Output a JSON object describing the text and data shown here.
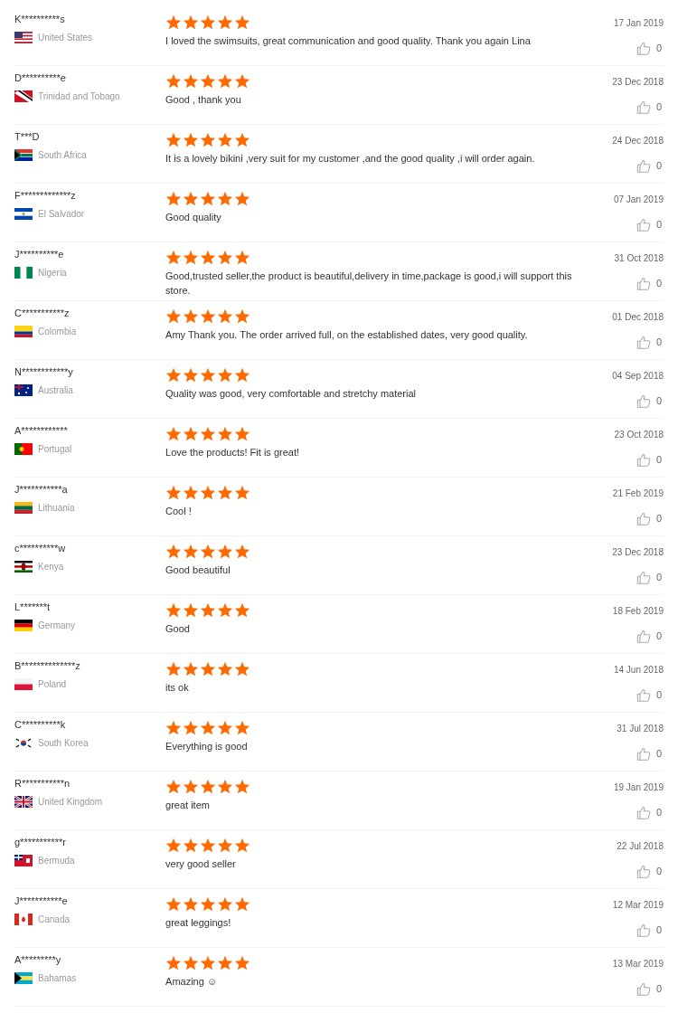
{
  "reviews": [
    {
      "name": "K**********s",
      "country": "United States",
      "kind": "us",
      "stars": 5,
      "text": "I loved the swimsuits, great communication and good quality. Thank you again Lina",
      "date": "17 Jan 2019",
      "likes": "0"
    },
    {
      "name": "D**********e",
      "country": "Trinidad and Tobago",
      "kind": "tt",
      "stars": 5,
      "text": "Good , thank you",
      "date": "23 Dec 2018",
      "likes": "0"
    },
    {
      "name": "T***D",
      "country": "South Africa",
      "kind": "za",
      "stars": 5,
      "text": "It is a lovely bikini ,very suit for my customer ,and the good quality ,i will order again.",
      "date": "24 Dec 2018",
      "likes": "0"
    },
    {
      "name": "F*************z",
      "country": "El Salvador",
      "kind": "sv",
      "stars": 5,
      "text": "Good quality",
      "date": "07 Jan 2019",
      "likes": "0"
    },
    {
      "name": "J**********e",
      "country": "Nigeria",
      "kind": "ng",
      "stars": 5,
      "text": "Good,trusted seller,the product is beautiful,delivery in time,package is good,i will support this store.",
      "date": "31 Oct 2018",
      "likes": "0"
    },
    {
      "name": "C***********z",
      "country": "Colombia",
      "kind": "co",
      "stars": 5,
      "text": "Amy Thank you. The order arrived full, on the established dates, very good quality.",
      "date": "01 Dec 2018",
      "likes": "0"
    },
    {
      "name": "N************y",
      "country": "Australia",
      "kind": "au",
      "stars": 5,
      "text": "Quality was good, very comfortable and stretchy material",
      "date": "04 Sep 2018",
      "likes": "0"
    },
    {
      "name": "A************",
      "country": "Portugal",
      "kind": "pt",
      "stars": 5,
      "text": "Love the products! Fit is great!",
      "date": "23 Oct 2018",
      "likes": "0"
    },
    {
      "name": "J***********a",
      "country": "Lithuania",
      "kind": "lt",
      "stars": 5,
      "text": "Cool !",
      "date": "21 Feb 2019",
      "likes": "0"
    },
    {
      "name": "c**********w",
      "country": "Kenya",
      "kind": "ke",
      "stars": 5,
      "text": "Good beautiful",
      "date": "23 Dec 2018",
      "likes": "0"
    },
    {
      "name": "L*******t",
      "country": "Germany",
      "kind": "de",
      "stars": 5,
      "text": "Good",
      "date": "18 Feb 2019",
      "likes": "0"
    },
    {
      "name": "B**************z",
      "country": "Poland",
      "kind": "pl",
      "stars": 5,
      "text": "its ok",
      "date": "14 Jun 2018",
      "likes": "0"
    },
    {
      "name": "C**********k",
      "country": "South Korea",
      "kind": "kr",
      "stars": 5,
      "text": "Everything is good",
      "date": "31 Jul 2018",
      "likes": "0"
    },
    {
      "name": "R***********n",
      "country": "United Kingdom",
      "kind": "gb",
      "stars": 5,
      "text": "great item",
      "date": "19 Jan 2019",
      "likes": "0"
    },
    {
      "name": "g***********r",
      "country": "Bermuda",
      "kind": "bm",
      "stars": 5,
      "text": "very good seller",
      "date": "22 Jul 2018",
      "likes": "0"
    },
    {
      "name": "J***********e",
      "country": "Canada",
      "kind": "ca",
      "stars": 5,
      "text": "great leggings!",
      "date": "12 Mar 2019",
      "likes": "0"
    },
    {
      "name": "A*********y",
      "country": "Bahamas",
      "kind": "bs",
      "stars": 5,
      "text": "Amazing ☺",
      "date": "13 Mar 2019",
      "likes": "0"
    }
  ]
}
